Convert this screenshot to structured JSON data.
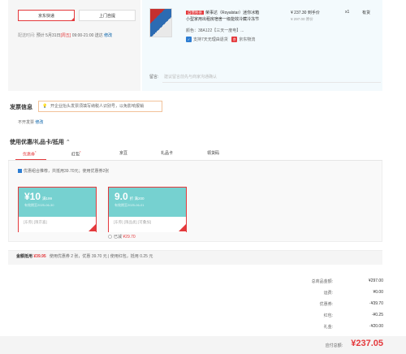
{
  "shipping": {
    "option_jd": "京东快递",
    "option_pickup": "上门自提",
    "delivery_label": "配送时间:",
    "delivery_value_prefix": "预计 5月31日",
    "delivery_weekday": "[周五]",
    "delivery_value_suffix": "09:00-21:00 送达",
    "modify": "修改"
  },
  "product": {
    "tag": "自营秒杀",
    "title_line1": "荣事达（Royalstar）迷你冰箱",
    "title_line2": "小型家用出租房宿舍一级能效冷藏冷冻节",
    "color_line": "颜色：38A122【三天一度电】...",
    "service1": "支持7天无理由退货",
    "service2": "京东物流",
    "price": "¥ 237.30 到手价",
    "original_price": "¥ 297.00  原价",
    "qty": "x1",
    "stock": "有货"
  },
  "message": {
    "label": "留言:",
    "placeholder": "建议留言前先与商家沟通确认"
  },
  "invoice": {
    "title": "发票信息",
    "tip": "开企业抬头发票须填写纳税人识别号，以免影响报销",
    "status": "不开发票",
    "modify": "修改"
  },
  "discount": {
    "title": "使用优惠/礼品卡/抵用",
    "tabs": [
      {
        "label": "优惠券",
        "badge": "*"
      },
      {
        "label": "红包",
        "badge": "*"
      },
      {
        "label": "京豆",
        "badge": ""
      },
      {
        "label": "礼品卡",
        "badge": ""
      },
      {
        "label": "领货码",
        "badge": ""
      }
    ],
    "best_combo": "优惠组合推荐，共抵用39.70元；使用优惠券2张",
    "coupons": [
      {
        "amount": "¥10",
        "condition": "满199",
        "date": "有效期至2025-06-30",
        "scope": "[东券] [限京喜]"
      },
      {
        "amount": "9.0",
        "condition": "折 满200",
        "date": "有效期至2025-06-01",
        "scope": "[东券] [限品类] [可叠加]"
      }
    ],
    "saved_label": "已减",
    "saved_value": "¥29.70",
    "summary_label": "金额抵用",
    "summary_amount": "¥39.95",
    "summary_detail": "使用优惠券 2 张，优惠 39.70 元 | 使用红包，抵用 0.25 元"
  },
  "totals": [
    {
      "label": "总商品金额:",
      "value": "¥297.00"
    },
    {
      "label": "运费:",
      "value": "¥0.00"
    },
    {
      "label": "优惠券:",
      "value": "-¥39.70"
    },
    {
      "label": "红包:",
      "value": "-¥0.25"
    },
    {
      "label": "礼金:",
      "value": "-¥20.00"
    }
  ],
  "payable": {
    "label": "应付总额:",
    "value": "¥237.05"
  }
}
